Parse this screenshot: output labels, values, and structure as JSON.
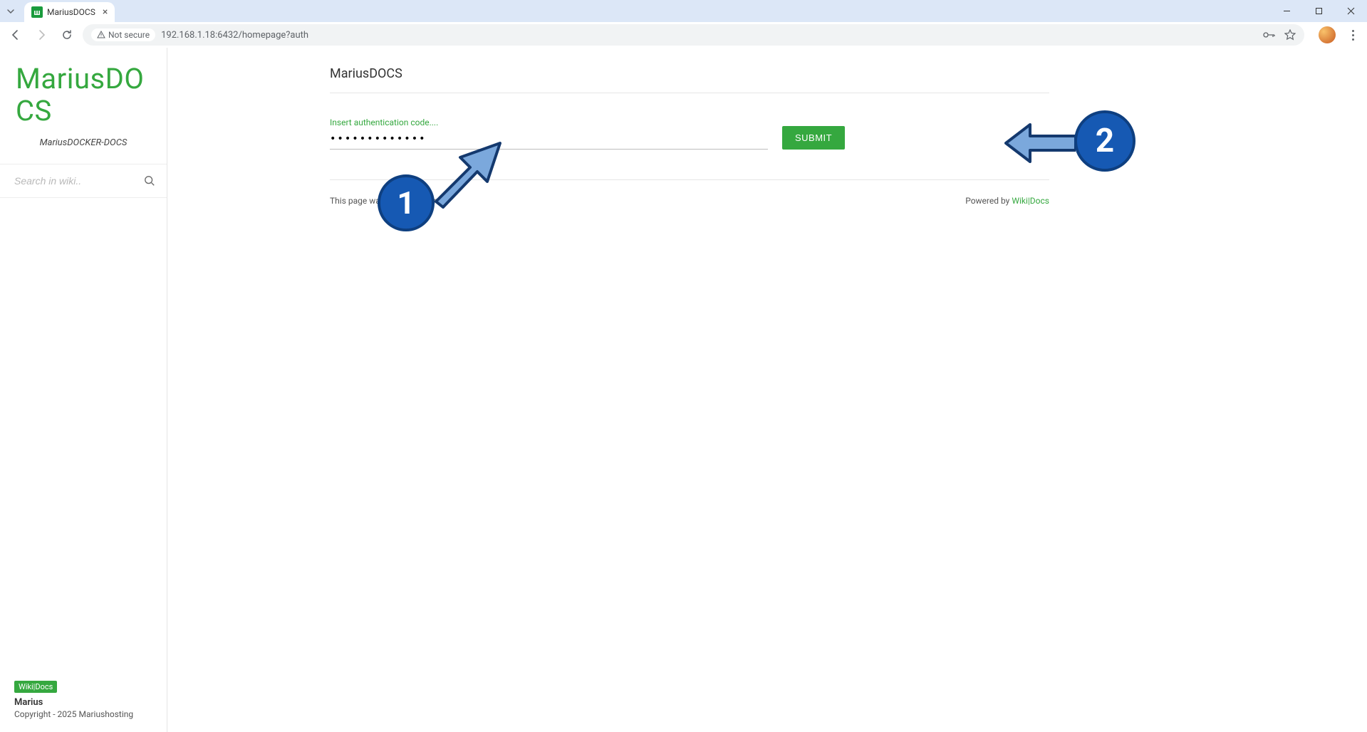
{
  "browser": {
    "tab_title": "MariusDOCS",
    "tab_favicon_glyph": "ш",
    "url": "192.168.1.18:6432/homepage?auth",
    "security_label": "Not secure"
  },
  "sidebar": {
    "site_title": "MariusDOCS",
    "site_subtitle": "MariusDOCKER-DOCS",
    "search_placeholder": "Search in wiki..",
    "footer": {
      "badge": "Wiki|Docs",
      "author": "Marius",
      "copyright": "Copyright - 2025 Mariushosting"
    }
  },
  "main": {
    "page_title": "MariusDOCS",
    "auth_label": "Insert authentication code....",
    "auth_value": "•••••••••••••",
    "submit_label": "SUBMIT",
    "footer_left": "This page was last edited on",
    "footer_right_prefix": "Powered by ",
    "footer_right_link": "Wiki|Docs"
  },
  "annotations": {
    "callout1": "1",
    "callout2": "2"
  }
}
